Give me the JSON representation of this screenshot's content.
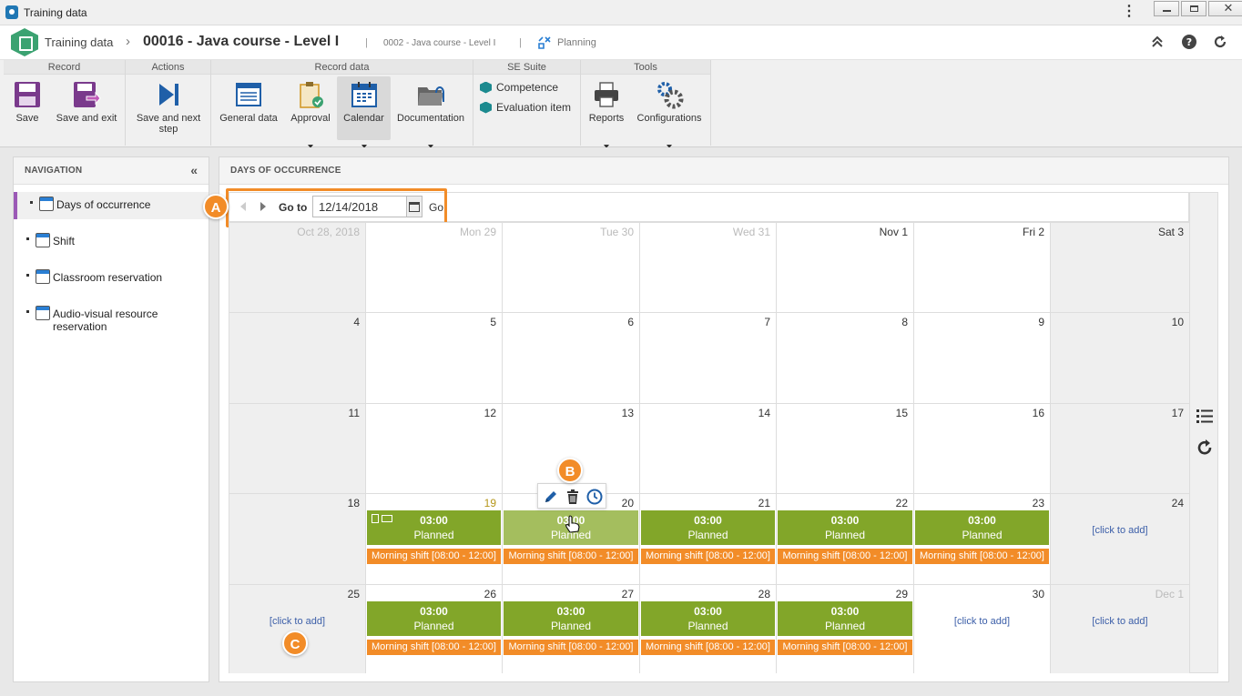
{
  "window": {
    "title": "Training data"
  },
  "header": {
    "crumb_root": "Training data",
    "crumb_record": "00016 - Java course - Level I",
    "crumb_sub": "0002 - Java course - Level I",
    "crumb_planning": "Planning",
    "pipe": "|"
  },
  "ribbon": {
    "groups": {
      "record": "Record",
      "actions": "Actions",
      "record_data": "Record data",
      "se_suite": "SE Suite",
      "tools": "Tools"
    },
    "buttons": {
      "save": "Save",
      "save_exit": "Save and exit",
      "save_next": "Save and next step",
      "general_data": "General data",
      "approval": "Approval",
      "calendar": "Calendar",
      "documentation": "Documentation",
      "reports": "Reports",
      "configurations": "Configurations"
    },
    "se_links": {
      "competence": "Competence",
      "evaluation_item": "Evaluation item"
    }
  },
  "navigation": {
    "title": "NAVIGATION",
    "items": [
      {
        "label": "Days of occurrence"
      },
      {
        "label": "Shift"
      },
      {
        "label": "Classroom reservation"
      },
      {
        "label": "Audio-visual resource reservation"
      }
    ]
  },
  "main": {
    "title": "DAYS OF OCCURRENCE",
    "goto_label": "Go to",
    "date_value": "12/14/2018",
    "go_label": "Go"
  },
  "calendar": {
    "headers": [
      "Oct 28, 2018",
      "Mon 29",
      "Tue 30",
      "Wed 31",
      "Nov 1",
      "Fri 2",
      "Sat 3"
    ],
    "weeks": [
      [
        "4",
        "5",
        "6",
        "7",
        "8",
        "9",
        "10"
      ],
      [
        "11",
        "12",
        "13",
        "14",
        "15",
        "16",
        "17"
      ],
      [
        "18",
        "19",
        "20",
        "21",
        "22",
        "23",
        "24"
      ],
      [
        "25",
        "26",
        "27",
        "28",
        "29",
        "30",
        "Dec 1"
      ]
    ],
    "event_time": "03:00",
    "event_status": "Planned",
    "shift_label": "Morning shift [08:00 - 12:00]",
    "add_label": "[click to add]"
  },
  "markers": {
    "a": "A",
    "b": "B",
    "c": "C"
  },
  "colors": {
    "event_green": "#82a629",
    "event_hover": "#a4be5e",
    "shift_orange": "#f28c28",
    "marker_orange": "#f28c28",
    "nav_active": "#9b59b6"
  }
}
